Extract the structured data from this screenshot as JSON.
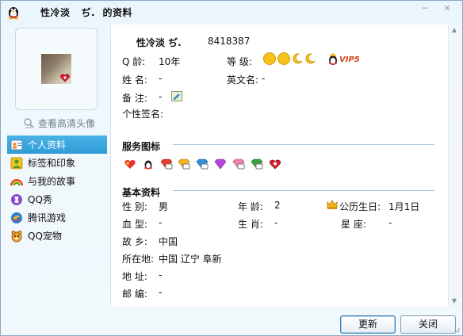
{
  "window": {
    "title": "性冷淡   ぢ.  的资料",
    "minimize_glyph": "─",
    "close_glyph": "✕"
  },
  "left": {
    "hd_avatar_link": "查看高清头像",
    "nav": [
      {
        "label": "个人资料",
        "icon": "profile-card-icon",
        "active": true
      },
      {
        "label": "标签和印象",
        "icon": "tag-user-icon",
        "active": false
      },
      {
        "label": "与我的故事",
        "icon": "rainbow-icon",
        "active": false
      },
      {
        "label": "QQ秀",
        "icon": "qqshow-icon",
        "active": false
      },
      {
        "label": "腾讯游戏",
        "icon": "tencent-games-icon",
        "active": false
      },
      {
        "label": "QQ宠物",
        "icon": "qq-pet-icon",
        "active": false
      }
    ]
  },
  "profile": {
    "nickname": "性冷淡   ぢ.",
    "qq_number": "8418387",
    "qage_label": "Q    龄:",
    "qage_value": "10年",
    "level_label": "等    级:",
    "vip_text": "VIP5",
    "name_label": "姓    名:",
    "name_value": "-",
    "english_name_label": "英文名:",
    "english_name_value": "-",
    "remark_label": "备    注:",
    "remark_value": "-",
    "signature_label": "个性签名:"
  },
  "services": {
    "title": "服务图标"
  },
  "basic": {
    "title": "基本资料",
    "gender_label": "性    别:",
    "gender_value": "男",
    "age_label": "年    龄:",
    "age_value": "2",
    "birthday_label": "公历生日:",
    "birthday_value": "1月1日",
    "blood_label": "血    型:",
    "blood_value": "-",
    "zodiac_label": "生    肖:",
    "zodiac_value": "-",
    "constellation_label": "星      座:",
    "constellation_value": "-",
    "hometown_label": "故    乡:",
    "hometown_value": "中国",
    "location_label": "所在地:",
    "location_value": "中国 辽宁 阜新",
    "address_label": "地    址:",
    "address_value": "-",
    "postcode_label": "邮    编:",
    "postcode_value": "-"
  },
  "buttons": {
    "refresh": "更新",
    "close": "关闭"
  },
  "colors": {
    "active_nav": "#2f9bd6",
    "accent_line": "#9fc6df",
    "vip": "#d4451a"
  }
}
